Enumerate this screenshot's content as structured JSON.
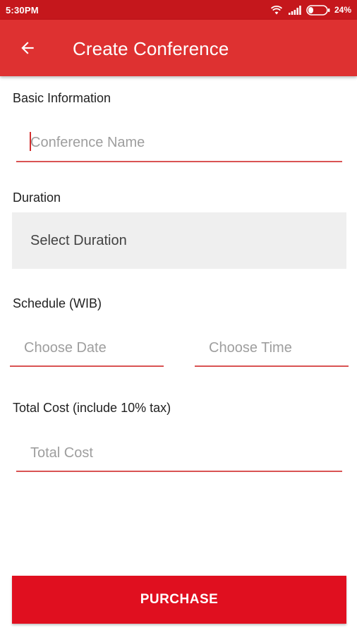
{
  "status_bar": {
    "time": "5:30PM",
    "battery": "24%",
    "icons": [
      "wifi-icon",
      "signal-icon",
      "battery-icon"
    ]
  },
  "app_bar": {
    "title": "Create Conference",
    "back_icon": "arrow-left-icon"
  },
  "form": {
    "basic_info_label": "Basic Information",
    "conference_name_placeholder": "Conference Name",
    "duration_label": "Duration",
    "duration_select": "Select Duration",
    "schedule_label": "Schedule (WIB)",
    "date_placeholder": "Choose Date",
    "time_placeholder": "Choose Time",
    "total_cost_label": "Total Cost (include 10% tax)",
    "total_cost_placeholder": "Total Cost"
  },
  "purchase_button_label": "PURCHASE",
  "colors": {
    "status_bar": "#c5171c",
    "app_bar": "#de3131",
    "accent_underline": "#d95353",
    "button": "#e00f1f",
    "select_background": "#efefef"
  }
}
